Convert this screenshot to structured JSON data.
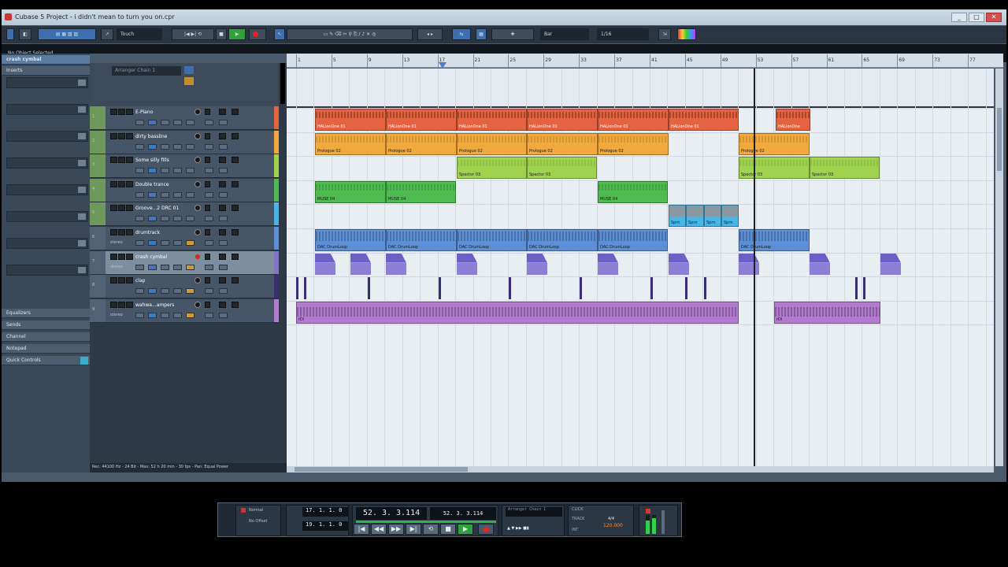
{
  "window": {
    "title": "Cubase 5 Project - i didn't mean to turn you on.cpr"
  },
  "toolbar": {
    "automation_mode": "Touch",
    "grid_type": "Bar",
    "quantize": "1/16"
  },
  "info_line": {
    "text": "No Object Selected"
  },
  "inspector": {
    "track_name": "crash cymbal",
    "sections": [
      "Inserts",
      "Equalizers",
      "Sends",
      "Channel",
      "Notepad",
      "Quick Controls"
    ]
  },
  "arranger": {
    "placeholder": "Arranger Chain 1"
  },
  "tracks": [
    {
      "num": "1",
      "name": "E-Piano",
      "color": "#e56340"
    },
    {
      "num": "2",
      "name": "dirty bassline",
      "color": "#f1a83c"
    },
    {
      "num": "3",
      "name": "Some silly fills",
      "color": "#9fd34f"
    },
    {
      "num": "4",
      "name": "Double trance",
      "color": "#4dbb4f"
    },
    {
      "num": "5",
      "name": "Groove...2 DRC 01",
      "color": "#47b5e6"
    },
    {
      "num": "6",
      "name": "drumtrack",
      "color": "#5d8fd6",
      "sub": "stereo"
    },
    {
      "num": "7",
      "name": "crash cymbal",
      "color": "#8771c9",
      "sub": "stereo"
    },
    {
      "num": "8",
      "name": "clap",
      "color": "#3a2e70"
    },
    {
      "num": "9",
      "name": "wahwa...ampers",
      "color": "#b37bd0",
      "sub": "stereo"
    }
  ],
  "ruler": {
    "ticks": [
      "1",
      "5",
      "9",
      "13",
      "17",
      "21",
      "25",
      "29",
      "33",
      "37",
      "41",
      "45",
      "49",
      "53",
      "57",
      "61",
      "65",
      "69",
      "73",
      "77"
    ]
  },
  "parts": {
    "epiano": [
      "HALionOne 01",
      "HALionOne 01",
      "HALionOne 01",
      "HALionOne 01",
      "HALionOne 01",
      "HALionOne 01",
      "HALionOne"
    ],
    "bass": [
      "Prologue 02",
      "Prologue 02",
      "Prologue 02",
      "Prologue 02",
      "Prologue 02",
      "Prologue 02"
    ],
    "fills": [
      "Spector 03",
      "Spector 03",
      "Spector 03",
      "Spector 03"
    ],
    "trance": [
      "MUSE 04",
      "MUSE 04",
      "MUSE 04"
    ],
    "groove": [
      "Sprn",
      "Sprn",
      "Sprn",
      "Sprn"
    ],
    "drumloop": [
      "DAC DrumLoop",
      "DAC DrumLoop",
      "DAC DrumLoop",
      "DAC DrumLoop",
      "DAC DrumLoop",
      "DAC DrumLoop"
    ],
    "wahwa": [
      "rDl",
      "rDl",
      "rDl"
    ]
  },
  "status_bar": {
    "text": "Rec: 44100 Hz - 24 Bit - Max: 52 h 20 min - 30 fps - Pan: Equal Power"
  },
  "transport": {
    "mode_top": "Normal",
    "mode_bottom": "No Offset",
    "left_locator": "17. 1. 1. 0",
    "right_locator": "19. 1. 1. 0",
    "position": "52. 3. 3.114",
    "position_secondary": "52. 3. 3.114",
    "marker": "Arranger Chain 1",
    "tempo": "120.000",
    "signature": "4/4",
    "tempo_label": "TRACK",
    "sync_label": "INT",
    "click_label": "CLICK"
  },
  "colors": {
    "titlebar": "#c4d2de",
    "toolbar": "#2b3542",
    "project_bg": "#e9eef2",
    "play": "#2ea33c",
    "record": "#e22222"
  }
}
